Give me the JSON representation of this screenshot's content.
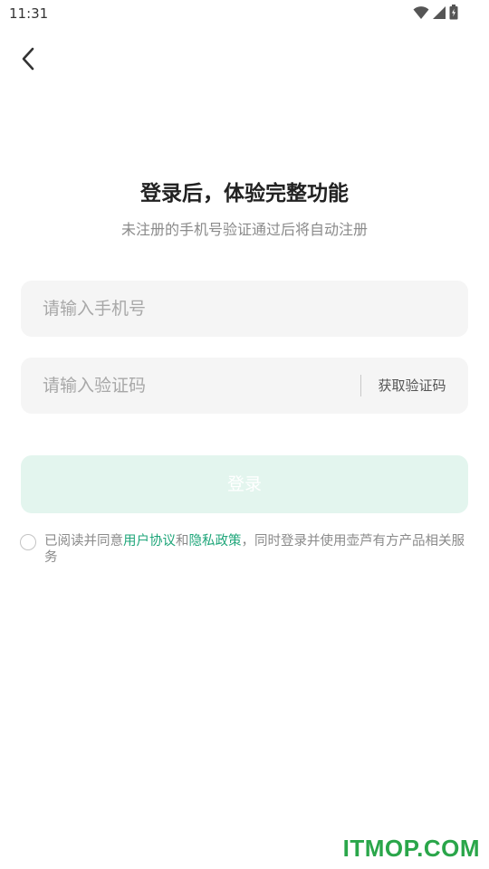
{
  "status_bar": {
    "time": "11:31",
    "icons": [
      "wifi-icon",
      "signal-icon",
      "battery-icon"
    ]
  },
  "header": {
    "back_icon": "chevron-left-icon"
  },
  "main": {
    "title": "登录后，体验完整功能",
    "subtitle": "未注册的手机号验证通过后将自动注册"
  },
  "form": {
    "phone": {
      "placeholder": "请输入手机号",
      "value": ""
    },
    "code": {
      "placeholder": "请输入验证码",
      "value": "",
      "get_code_label": "获取验证码"
    },
    "login_label": "登录"
  },
  "agreement": {
    "prefix": "已阅读并同意",
    "user_agreement": "用户协议",
    "and": "和",
    "privacy_policy": "隐私政策",
    "suffix": "，同时登录并使用壶芦有方产品相关服务",
    "checked": false
  },
  "watermark": "ITMOP.COM",
  "colors": {
    "accent": "#1fa67a",
    "login_button_disabled": "#e3f5ee",
    "field_background": "#f5f5f5",
    "watermark": "#2aa64a"
  }
}
